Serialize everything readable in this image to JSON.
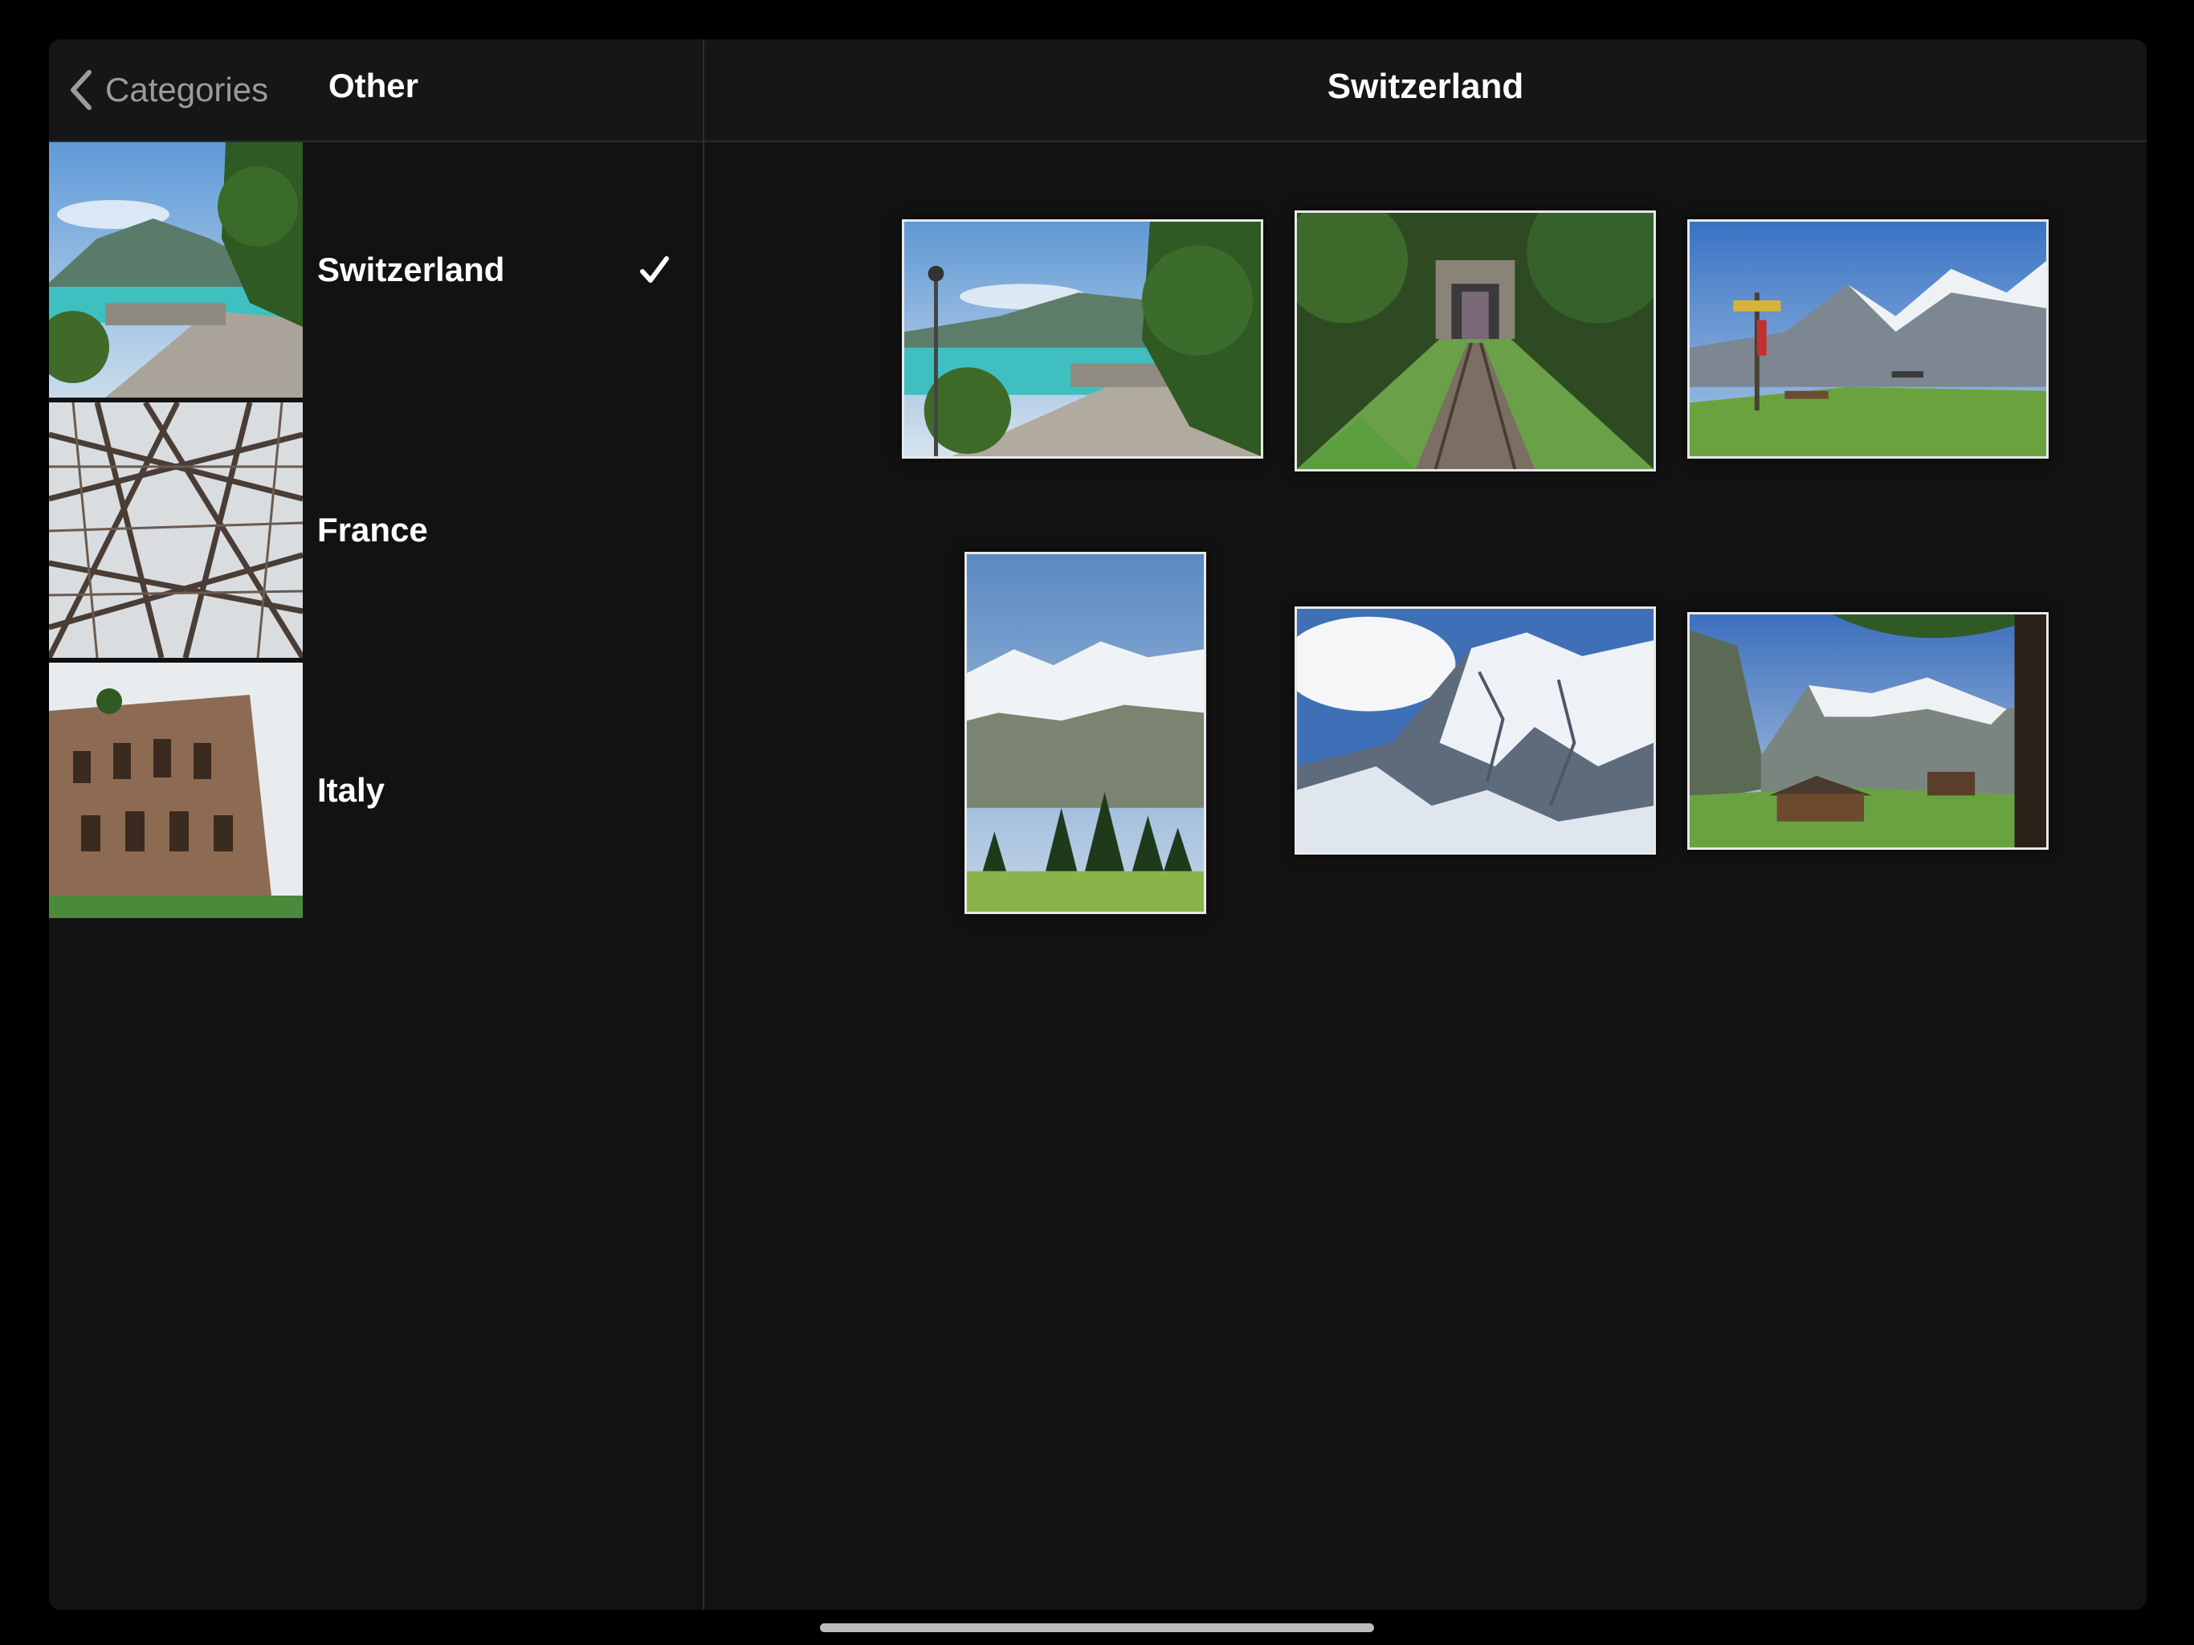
{
  "sidebar": {
    "back_label": "Categories",
    "title": "Other",
    "items": [
      {
        "label": "Switzerland",
        "selected": true
      },
      {
        "label": "France",
        "selected": false
      },
      {
        "label": "Italy",
        "selected": false
      }
    ]
  },
  "main": {
    "title": "Switzerland",
    "photos": [
      {
        "subject": "lakeside promenade"
      },
      {
        "subject": "funicular railway"
      },
      {
        "subject": "mountain signpost and bench"
      },
      {
        "subject": "alpine peaks with pine trees"
      },
      {
        "subject": "snowy mountain glacier"
      },
      {
        "subject": "chalet in valley"
      }
    ]
  },
  "colors": {
    "background": "#000000",
    "panel": "#121212",
    "header": "#161616",
    "secondary_text": "#9b9b9b",
    "accent_text": "#ffffff"
  }
}
